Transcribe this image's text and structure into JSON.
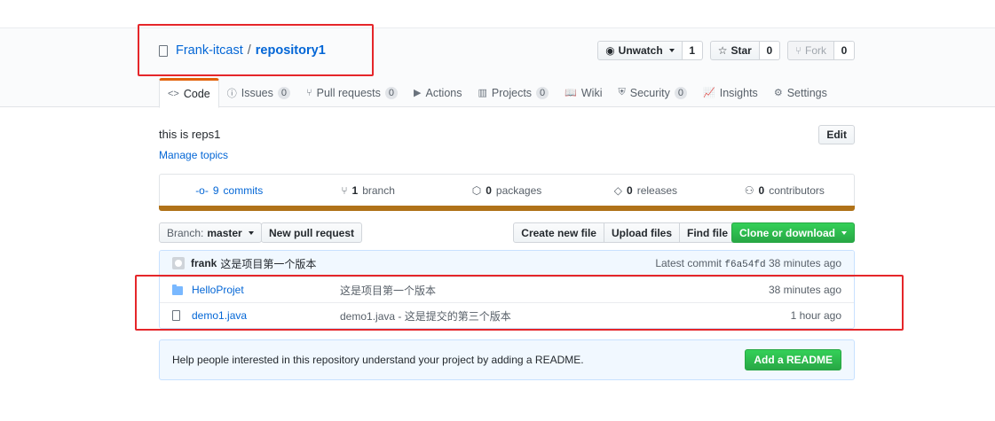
{
  "repo": {
    "owner": "Frank-itcast",
    "separator": "/",
    "name": "repository1"
  },
  "actions": {
    "watch": {
      "label": "Unwatch",
      "count": "1"
    },
    "star": {
      "label": "Star",
      "count": "0"
    },
    "fork": {
      "label": "Fork",
      "count": "0"
    }
  },
  "tabs": [
    {
      "label": "Code",
      "icon": "<>",
      "count": ""
    },
    {
      "label": "Issues",
      "icon": "ⓘ",
      "count": "0"
    },
    {
      "label": "Pull requests",
      "icon": "⑂",
      "count": "0"
    },
    {
      "label": "Actions",
      "icon": "▶",
      "count": ""
    },
    {
      "label": "Projects",
      "icon": "▥",
      "count": "0"
    },
    {
      "label": "Wiki",
      "icon": "📖",
      "count": ""
    },
    {
      "label": "Security",
      "icon": "⛨",
      "count": "0"
    },
    {
      "label": "Insights",
      "icon": "📈",
      "count": ""
    },
    {
      "label": "Settings",
      "icon": "⚙",
      "count": ""
    }
  ],
  "about": {
    "description": "this is reps1",
    "manage_topics": "Manage topics",
    "edit": "Edit"
  },
  "summary": {
    "commits_count": "9",
    "commits_label": "commits",
    "branch_count": "1",
    "branch_label": "branch",
    "packages_count": "0",
    "packages_label": "packages",
    "releases_count": "0",
    "releases_label": "releases",
    "contributors_count": "0",
    "contributors_label": "contributors"
  },
  "language_color": "#b07219",
  "filenav": {
    "branch_prefix": "Branch:",
    "branch_name": "master",
    "new_pr": "New pull request",
    "create_file": "Create new file",
    "upload_files": "Upload files",
    "find_file": "Find file",
    "clone": "Clone or download"
  },
  "latest_commit": {
    "author": "frank",
    "message": "这是项目第一个版本",
    "prefix": "Latest commit",
    "sha": "f6a54fd",
    "age": "38 minutes ago"
  },
  "files": [
    {
      "type": "folder",
      "name": "HelloProjet",
      "message": "这是项目第一个版本",
      "age": "38 minutes ago"
    },
    {
      "type": "file",
      "name": "demo1.java",
      "message": "demo1.java - 这是提交的第三个版本",
      "age": "1 hour ago"
    }
  ],
  "readme": {
    "text": "Help people interested in this repository understand your project by adding a README.",
    "button": "Add a README"
  },
  "colors": {
    "link": "#0366d6",
    "highlight": "#e5262a",
    "primary": "#28a745",
    "tab_accent": "#e36209"
  }
}
